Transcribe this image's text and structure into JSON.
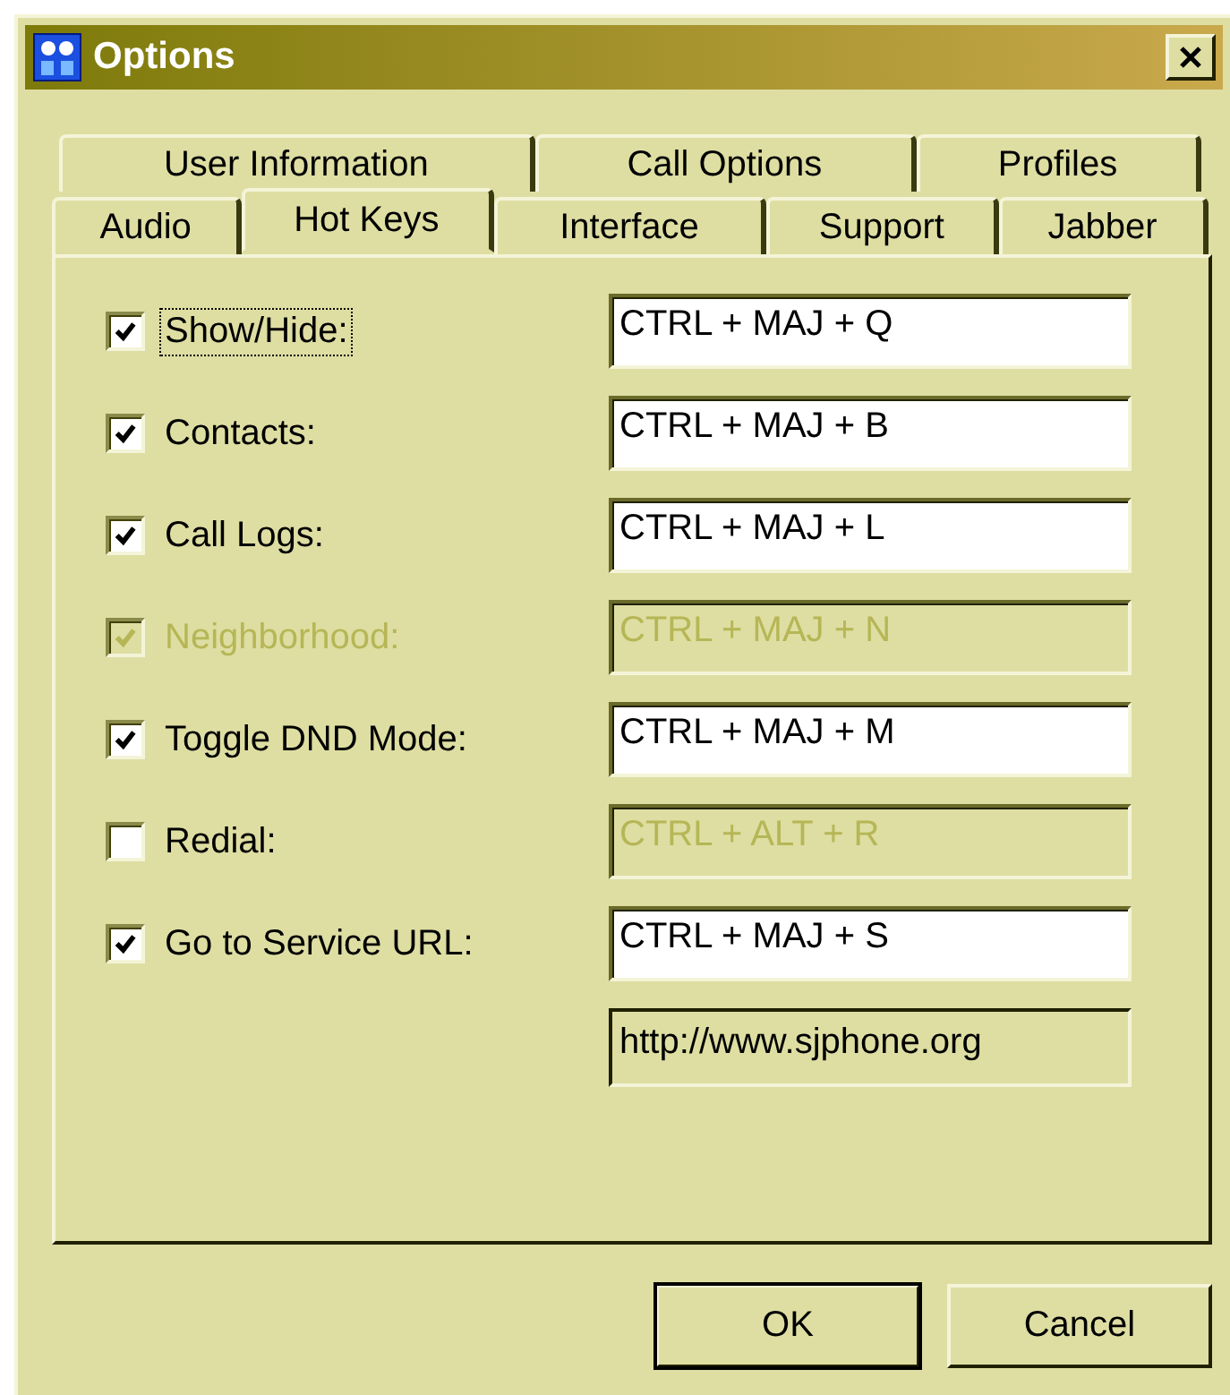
{
  "window": {
    "title": "Options"
  },
  "tabs": [
    [
      {
        "label": "User Information",
        "selected": false
      },
      {
        "label": "Call Options",
        "selected": false
      },
      {
        "label": "Profiles",
        "selected": false
      }
    ],
    [
      {
        "label": "Audio",
        "selected": false
      },
      {
        "label": "Hot Keys",
        "selected": true
      },
      {
        "label": "Interface",
        "selected": false
      },
      {
        "label": "Support",
        "selected": false
      },
      {
        "label": "Jabber",
        "selected": false
      }
    ]
  ],
  "hotkeys": [
    {
      "label": "Show/Hide:",
      "checked": true,
      "disabled": false,
      "focused": true,
      "value": "CTRL + MAJ + Q"
    },
    {
      "label": "Contacts:",
      "checked": true,
      "disabled": false,
      "focused": false,
      "value": "CTRL + MAJ + B"
    },
    {
      "label": "Call Logs:",
      "checked": true,
      "disabled": false,
      "focused": false,
      "value": "CTRL + MAJ + L"
    },
    {
      "label": "Neighborhood:",
      "checked": true,
      "disabled": true,
      "focused": false,
      "value": "CTRL + MAJ + N"
    },
    {
      "label": "Toggle DND Mode:",
      "checked": true,
      "disabled": false,
      "focused": false,
      "value": "CTRL + MAJ + M"
    },
    {
      "label": "Redial:",
      "checked": false,
      "disabled": false,
      "focused": false,
      "value": "CTRL + ALT + R"
    },
    {
      "label": "Go to Service URL:",
      "checked": true,
      "disabled": false,
      "focused": false,
      "value": "CTRL + MAJ + S"
    }
  ],
  "service_url": {
    "value": "http://www.sjphone.org"
  },
  "buttons": [
    {
      "label": "OK",
      "default": true
    },
    {
      "label": "Cancel",
      "default": false
    }
  ]
}
